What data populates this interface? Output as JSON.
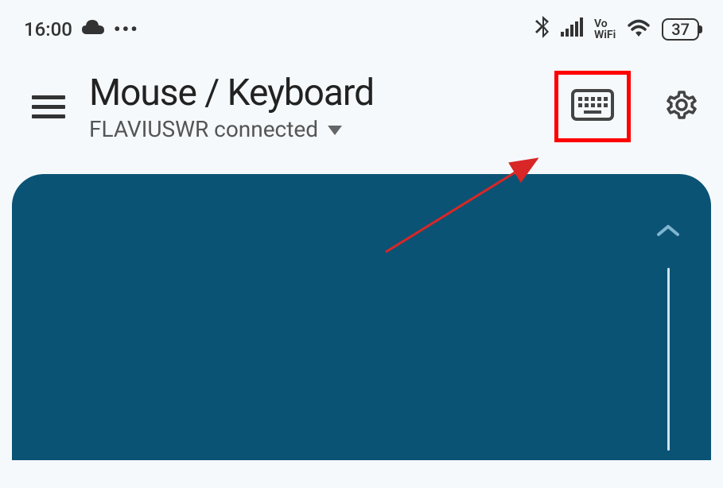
{
  "statusbar": {
    "time": "16:00",
    "battery_level": "37",
    "vowifi_label": "Vo\nWiFi"
  },
  "header": {
    "title": "Mouse / Keyboard",
    "connection_status": "FLAVIUSWR connected"
  }
}
